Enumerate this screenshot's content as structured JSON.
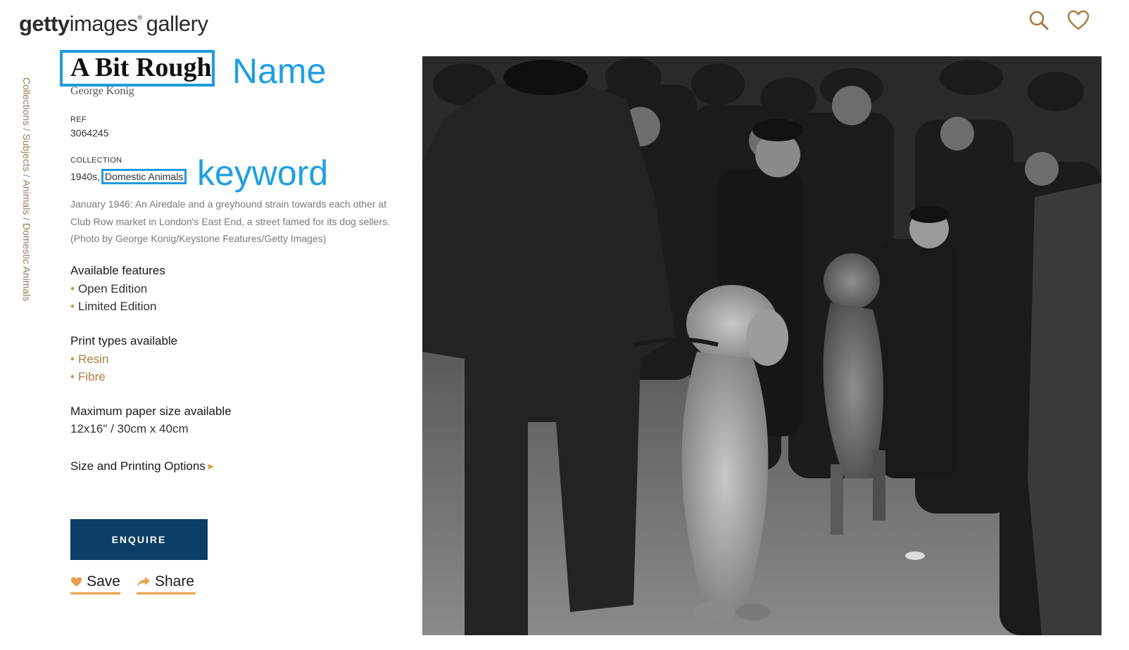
{
  "header": {
    "logo_bold": "getty",
    "logo_light": "images",
    "logo_mark": "®",
    "logo_gallery": "gallery",
    "icons": [
      "search-icon",
      "heart-icon"
    ]
  },
  "breadcrumb": {
    "collections": "Collections",
    "subjects": "Subjects",
    "animals": "Animals",
    "domestic": "Domestic Animals",
    "separator": " / "
  },
  "artwork": {
    "title": "A Bit Rough",
    "artist": "George Konig",
    "ref_label": "REF",
    "ref_value": "3064245",
    "collection_label": "COLLECTION",
    "collection_prefix": "1940s,",
    "collection_keyword": "Domestic Animals",
    "description": "January 1946: An Airedale and a greyhound strain towards each other at Club Row market in London's East End, a street famed for its dog sellers. (Photo by George Konig/Keystone Features/Getty Images)"
  },
  "annotations": {
    "name": "Name",
    "keyword": "keyword"
  },
  "features": {
    "title": "Available features",
    "items": [
      "Open Edition",
      "Limited Edition"
    ]
  },
  "print_types": {
    "title": "Print types available",
    "items": [
      "Resin",
      "Fibre"
    ]
  },
  "paper": {
    "title": "Maximum paper size available",
    "value": "12x16\" / 30cm x 40cm"
  },
  "options_link": "Size and Printing Options",
  "buttons": {
    "enquire": "ENQUIRE",
    "save": "Save",
    "share": "Share"
  },
  "colors": {
    "accent": "#c9954c",
    "annotation": "#1f9ae0",
    "enquire_bg": "#0a3e66"
  }
}
